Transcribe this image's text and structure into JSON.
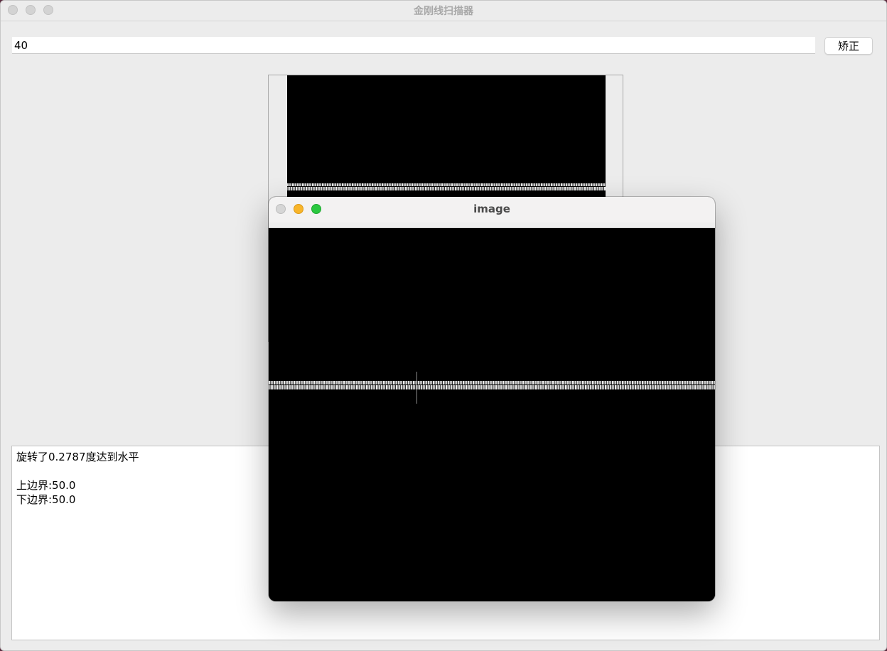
{
  "main_window": {
    "title": "金刚线扫描器",
    "angle_input": {
      "value": "40"
    },
    "correct_button": {
      "label": "矫正"
    },
    "log": {
      "lines": [
        "旋转了0.2787度达到水平",
        "",
        "上边界:50.0",
        "下边界:50.0"
      ]
    }
  },
  "image_window": {
    "title": "image"
  },
  "colors": {
    "window_bg": "#ececec",
    "desktop": "#5a2a3e",
    "close": "#d6d6d6",
    "minimize": "#f8b52a",
    "maximize": "#2ac840"
  }
}
